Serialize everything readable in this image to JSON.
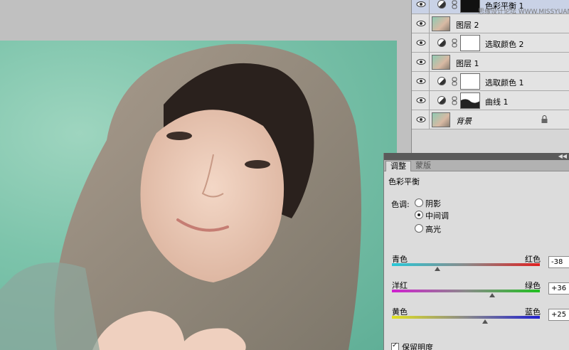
{
  "layers_panel": {
    "watermark": "思缘设计论坛 WWW.MISSYUAN.COM",
    "layers": [
      {
        "name": "色彩平衡 1",
        "kind": "adjustment",
        "selected": true
      },
      {
        "name": "图层 2",
        "kind": "image",
        "selected": false
      },
      {
        "name": "选取颜色 2",
        "kind": "adjustment",
        "selected": false
      },
      {
        "name": "图层 1",
        "kind": "image",
        "selected": false
      },
      {
        "name": "选取颜色 1",
        "kind": "adjustment",
        "selected": false
      },
      {
        "name": "曲线 1",
        "kind": "adjustment",
        "selected": false
      },
      {
        "name": "背景",
        "kind": "background",
        "selected": false
      }
    ]
  },
  "adjustments_panel": {
    "tabs": [
      "调整",
      "蒙版"
    ],
    "title": "色彩平衡",
    "tone_label": "色调:",
    "tone_options": [
      "阴影",
      "中间调",
      "高光"
    ],
    "tone_selected": "中间调",
    "sliders": [
      {
        "left": "青色",
        "right": "红色",
        "value": "-38",
        "position": 0.31
      },
      {
        "left": "洋红",
        "right": "绿色",
        "value": "+36",
        "position": 0.68
      },
      {
        "left": "黄色",
        "right": "蓝色",
        "value": "+25",
        "position": 0.63
      }
    ],
    "preserve_label": "保留明度",
    "preserve_checked": true
  },
  "colors": {
    "panel_bg": "#dcdcdc",
    "selected_layer": "#c9d2e6",
    "canvas_bg": "#c0c0c0"
  }
}
